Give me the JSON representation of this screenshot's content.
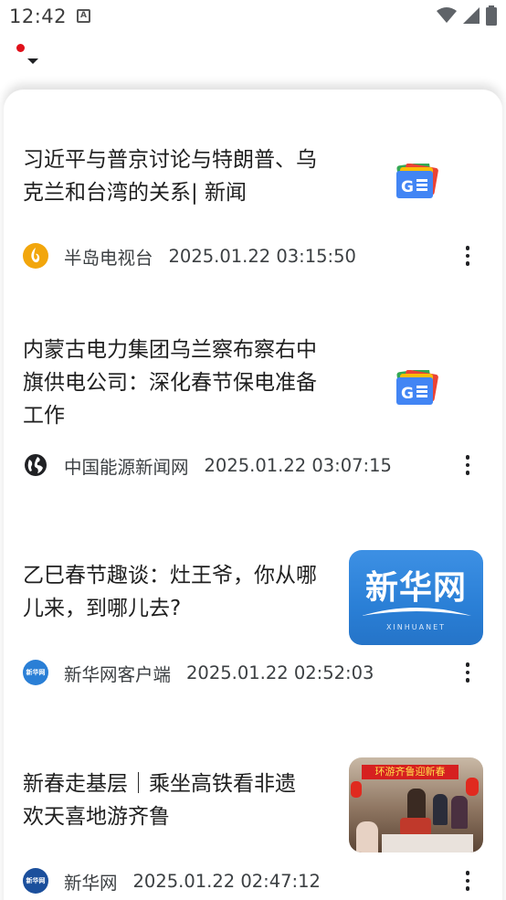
{
  "status_bar": {
    "time": "12:42",
    "notification_icon": "A",
    "icons": [
      "wifi-icon",
      "signal-icon",
      "battery-icon"
    ]
  },
  "articles": [
    {
      "title_line1": "习近平与普京讨论与特朗普、乌",
      "title_line2": "克兰和台湾的关系| 新闻",
      "source": "半岛电视台",
      "time": "2025.01.22 03:15:50",
      "thumbnail": "google-news-icon"
    },
    {
      "title_line1": "内蒙古电力集团乌兰察布察右中",
      "title_line2": "旗供电公司：深化春节保电准备",
      "title_line3": "工作",
      "source": "中国能源新闻网",
      "time": "2025.01.22 03:07:15",
      "thumbnail": "google-news-icon"
    },
    {
      "title_line1": "乙巳春节趣谈：灶王爷，你从哪",
      "title_line2": "儿来，到哪儿去?",
      "source": "新华网客户端",
      "time": "2025.01.22 02:52:03",
      "thumbnail": "xinhua-logo",
      "thumbnail_text": "新华网",
      "thumbnail_subtext": "XINHUANET"
    },
    {
      "title_line1": "新春走基层｜乘坐高铁看非遗",
      "title_line2": "欢天喜地游齐鲁",
      "source": "新华网",
      "time": "2025.01.22 02:47:12",
      "thumbnail": "train-photo",
      "thumbnail_text": "环游齐鲁迎新春"
    }
  ],
  "colors": {
    "accent_red": "#e0101a",
    "xinhua_blue": "#2a7fd6",
    "aljazeera_gold": "#f2a60c"
  }
}
